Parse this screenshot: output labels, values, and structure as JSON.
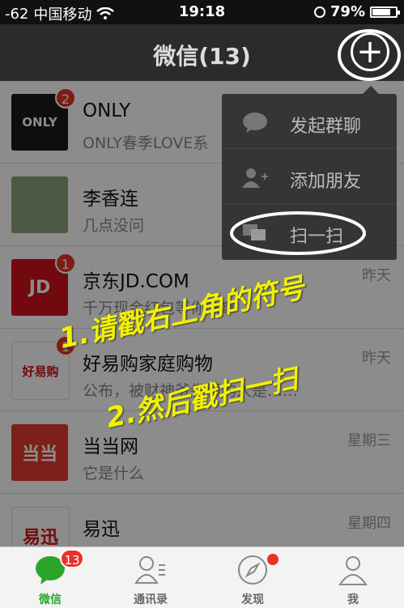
{
  "status_bar": {
    "signal": "-62",
    "carrier": "中国移动",
    "time": "19:18",
    "battery": "79%",
    "battery_level": 0.79,
    "icons": [
      "wifi-icon",
      "clock-icon",
      "battery-icon"
    ]
  },
  "nav": {
    "title": "微信(13)",
    "add_icon": "plus-icon"
  },
  "chats": [
    {
      "name": "ONLY",
      "message": "ONLY春季LOVE系",
      "time": "",
      "badge": "2",
      "avatar_text": "ONLY",
      "avatar_color": "#1a1a1a"
    },
    {
      "name": "李香连",
      "message": "几点没问",
      "time": "",
      "badge": "",
      "avatar_text": "",
      "avatar_color": "#8aa37a"
    },
    {
      "name": "京东JD.COM",
      "message": "千万现金红包等你来拿",
      "time": "昨天",
      "badge": "1",
      "avatar_text": "JD",
      "avatar_color": "#d0121b"
    },
    {
      "name": "好易购家庭购物",
      "message": "公布，被财神爷眷顾的人是……",
      "time": "昨天",
      "badge": "1",
      "avatar_text": "好易购",
      "avatar_color": "#ffffff"
    },
    {
      "name": "当当网",
      "message": "它是什么",
      "time": "星期三",
      "badge": "",
      "avatar_text": "当当",
      "avatar_color": "#e43b2e"
    },
    {
      "name": "易迅",
      "message": "",
      "time": "星期四",
      "badge": "",
      "avatar_text": "易迅",
      "avatar_color": "#ffffff"
    }
  ],
  "popup_menu": [
    {
      "label": "发起群聊",
      "icon": "chat-bubble-icon"
    },
    {
      "label": "添加朋友",
      "icon": "add-friend-icon"
    },
    {
      "label": "扫一扫",
      "icon": "scan-icon"
    }
  ],
  "annotations": {
    "line1": "1.请戳右上角的符号",
    "line2": "2.然后戳扫一扫"
  },
  "tabs": [
    {
      "label": "微信",
      "icon": "chat-icon",
      "badge": "13",
      "active": true
    },
    {
      "label": "通讯录",
      "icon": "contacts-icon",
      "badge": "",
      "active": false
    },
    {
      "label": "发现",
      "icon": "compass-icon",
      "badge": "dot",
      "active": false
    },
    {
      "label": "我",
      "icon": "person-icon",
      "badge": "",
      "active": false
    }
  ],
  "colors": {
    "accent_green": "#2aa52a",
    "badge_red": "#e6332a",
    "annotation_yellow": "#f0f000"
  }
}
